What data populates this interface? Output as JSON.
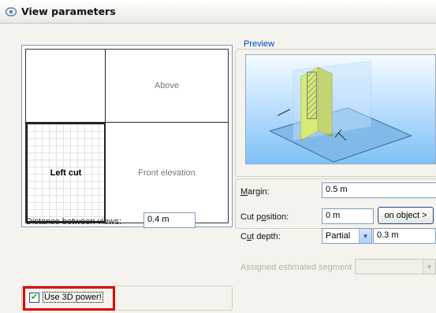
{
  "window": {
    "title": "View parameters"
  },
  "views": {
    "top_right": "Above",
    "bottom_left": "Left cut",
    "bottom_right": "Front elevation"
  },
  "distance": {
    "label": "Distance between views:",
    "value": "0.4 m"
  },
  "preview": {
    "title": "Preview"
  },
  "params": {
    "margin": {
      "label_pre": "",
      "label_u": "M",
      "label_post": "argin:",
      "value": "0.5 m"
    },
    "cut_position": {
      "label_pre": "Cut p",
      "label_u": "o",
      "label_post": "sition:",
      "value": "0 m",
      "button": "on object >"
    },
    "cut_depth": {
      "label_pre": "C",
      "label_u": "u",
      "label_post": "t depth:",
      "mode": "Partial",
      "value": "0.3 m"
    }
  },
  "segment": {
    "label": "Assigned estimated segment",
    "value": ""
  },
  "use3d": {
    "label": "Use 3D power!",
    "checked": true
  },
  "colors": {
    "highlight": "#e00000",
    "preview_sky": "#7fc0f5",
    "group_title": "#0046d5"
  }
}
